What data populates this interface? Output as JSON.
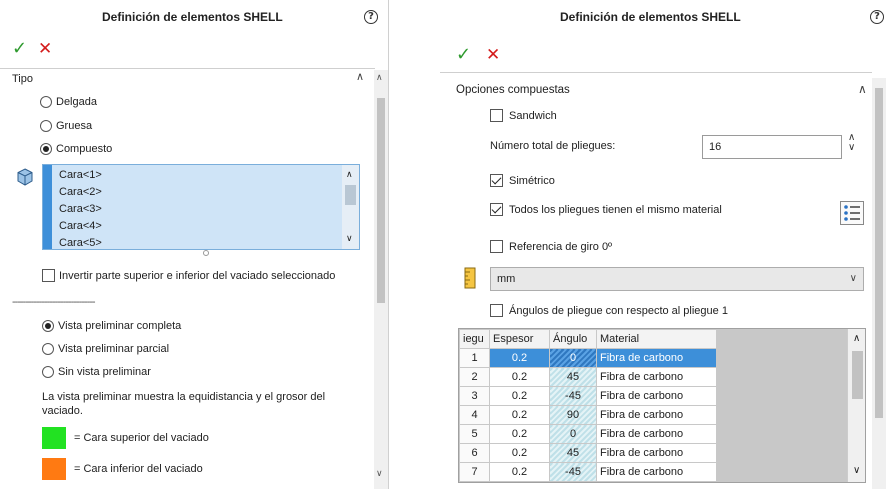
{
  "left_panel": {
    "title": "Definición de elementos SHELL",
    "help": "?",
    "ok_symbol": "✓",
    "cancel_symbol": "✕",
    "section_tipo": "Tipo",
    "type_options": [
      {
        "label": "Delgada",
        "selected": false
      },
      {
        "label": "Gruesa",
        "selected": false
      },
      {
        "label": "Compuesto",
        "selected": true
      }
    ],
    "faces": [
      "Cara<1>",
      "Cara<2>",
      "Cara<3>",
      "Cara<4>",
      "Cara<5>"
    ],
    "invert_label": "Invertir parte superior e inferior del vaciado seleccionado",
    "invert_checked": false,
    "dashes": "-------------------------------",
    "preview_options": [
      {
        "label": "Vista preliminar completa",
        "selected": true
      },
      {
        "label": "Vista preliminar parcial",
        "selected": false
      },
      {
        "label": "Sin vista preliminar",
        "selected": false
      }
    ],
    "preview_note": "La vista preliminar muestra la equidistancia y el grosor del vaciado.",
    "legend": [
      {
        "color": "#22e222",
        "label": "= Cara superior del vaciado"
      },
      {
        "color": "#ff7a12",
        "label": "= Cara inferior del vaciado"
      }
    ]
  },
  "right_panel": {
    "title": "Definición de elementos SHELL",
    "help": "?",
    "ok_symbol": "✓",
    "cancel_symbol": "✕",
    "section_title": "Opciones compuestas",
    "sandwich_label": "Sandwich",
    "sandwich_checked": false,
    "total_plies_label": "Número total de pliegues:",
    "total_plies_value": "16",
    "symmetric_label": "Simétrico",
    "symmetric_checked": true,
    "same_material_label": "Todos los pliegues tienen el mismo material",
    "same_material_checked": true,
    "ref_label": "Referencia de giro 0º",
    "ref_checked": false,
    "units_value": "mm",
    "angles_label": "Ángulos de pliegue con respecto al pliegue 1",
    "angles_checked": false,
    "table": {
      "headers": [
        "iegu",
        "Espesor",
        "Ángulo",
        "Material"
      ],
      "rows": [
        {
          "n": "1",
          "espesor": "0.2",
          "angulo": "0",
          "material": "Fibra de carbono"
        },
        {
          "n": "2",
          "espesor": "0.2",
          "angulo": "45",
          "material": "Fibra de carbono"
        },
        {
          "n": "3",
          "espesor": "0.2",
          "angulo": "-45",
          "material": "Fibra de carbono"
        },
        {
          "n": "4",
          "espesor": "0.2",
          "angulo": "90",
          "material": "Fibra de carbono"
        },
        {
          "n": "5",
          "espesor": "0.2",
          "angulo": "0",
          "material": "Fibra de carbono"
        },
        {
          "n": "6",
          "espesor": "0.2",
          "angulo": "45",
          "material": "Fibra de carbono"
        },
        {
          "n": "7",
          "espesor": "0.2",
          "angulo": "-45",
          "material": "Fibra de carbono"
        }
      ]
    }
  }
}
